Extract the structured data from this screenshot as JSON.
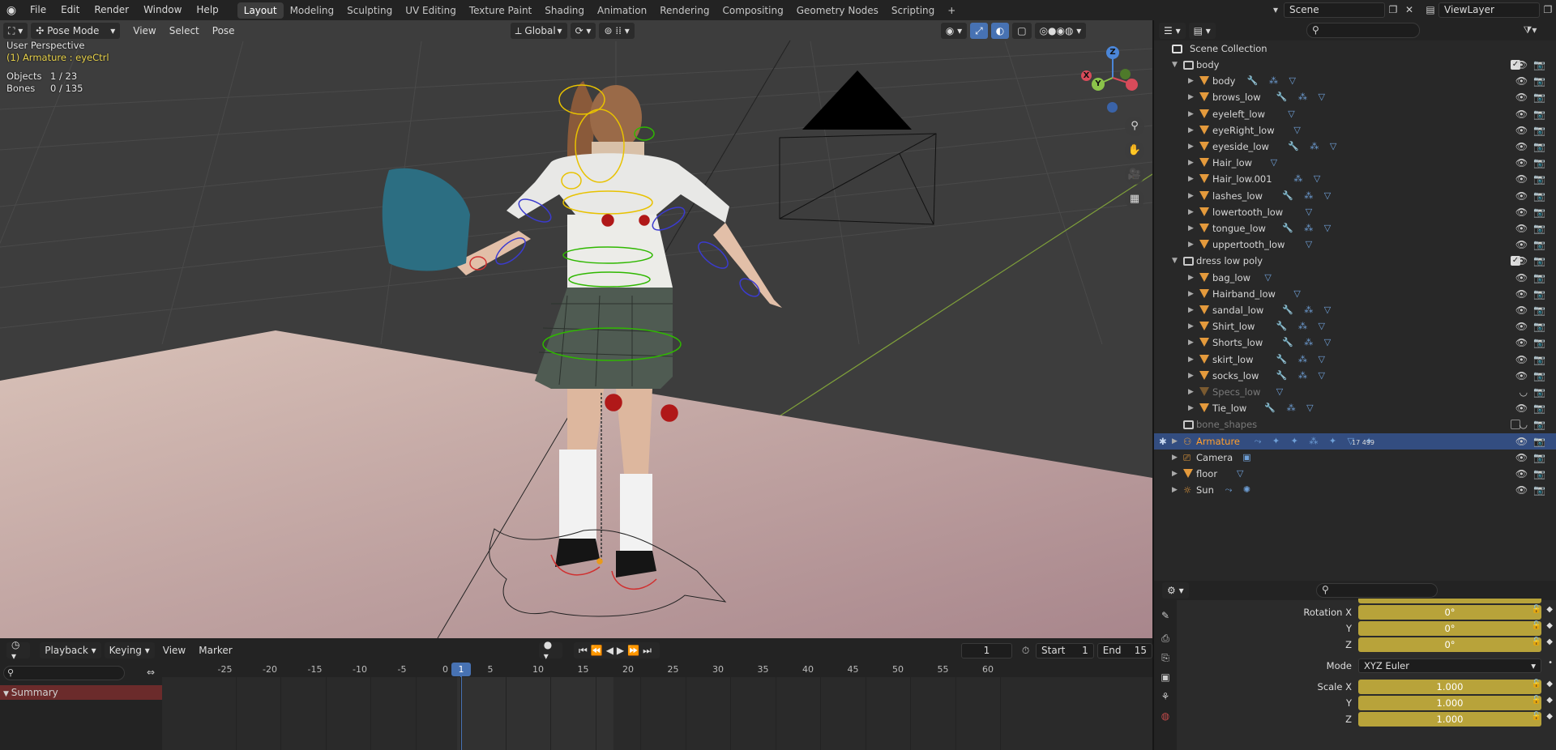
{
  "topbar": {
    "menus": [
      "File",
      "Edit",
      "Render",
      "Window",
      "Help"
    ],
    "workspaces": [
      "Layout",
      "Modeling",
      "Sculpting",
      "UV Editing",
      "Texture Paint",
      "Shading",
      "Animation",
      "Rendering",
      "Compositing",
      "Geometry Nodes",
      "Scripting"
    ],
    "active_workspace": "Layout",
    "add_tab": "+",
    "scene": "Scene",
    "view_layer": "ViewLayer"
  },
  "viewport": {
    "mode": "Pose Mode",
    "menus": [
      "View",
      "Select",
      "Pose"
    ],
    "transform_orientation": "Global",
    "perspective": "User Perspective",
    "active_object": "(1) Armature : eyeCtrl",
    "stats": [
      {
        "label": "Objects",
        "value": "1 / 23"
      },
      {
        "label": "Bones",
        "value": "0 / 135"
      }
    ],
    "gizmo_axes": {
      "z": "Z",
      "y": "Y",
      "x": "X"
    }
  },
  "timeline": {
    "menus": [
      "Playback",
      "Keying",
      "View",
      "Marker"
    ],
    "current_frame": "1",
    "start_label": "Start",
    "start": "1",
    "end_label": "End",
    "end": "15",
    "ruler": [
      "-25",
      "-20",
      "-15",
      "-10",
      "-5",
      "0",
      "5",
      "10",
      "15",
      "20",
      "25",
      "30",
      "35",
      "40",
      "45",
      "50",
      "55",
      "60"
    ],
    "playhead": "1",
    "summary": "Summary"
  },
  "outliner": {
    "root": "Scene Collection",
    "rows": [
      {
        "name": "body",
        "kind": "collection",
        "level": 1,
        "checkbox": true
      },
      {
        "name": "body",
        "kind": "mesh",
        "level": 2,
        "mods": "🔧 ⁂ ▽"
      },
      {
        "name": "brows_low",
        "kind": "mesh",
        "level": 2,
        "mods": "🔧 ⁂ ▽"
      },
      {
        "name": "eyeleft_low",
        "kind": "mesh",
        "level": 2,
        "mods": "▽"
      },
      {
        "name": "eyeRight_low",
        "kind": "mesh",
        "level": 2,
        "mods": "▽"
      },
      {
        "name": "eyeside_low",
        "kind": "mesh",
        "level": 2,
        "mods": "🔧 ⁂ ▽"
      },
      {
        "name": "Hair_low",
        "kind": "mesh",
        "level": 2,
        "mods": "▽"
      },
      {
        "name": "Hair_low.001",
        "kind": "mesh",
        "level": 2,
        "mods": "⁂ ▽"
      },
      {
        "name": "lashes_low",
        "kind": "mesh",
        "level": 2,
        "mods": "🔧 ⁂ ▽"
      },
      {
        "name": "lowertooth_low",
        "kind": "mesh",
        "level": 2,
        "mods": "▽"
      },
      {
        "name": "tongue_low",
        "kind": "mesh",
        "level": 2,
        "mods": "🔧 ⁂ ▽"
      },
      {
        "name": "uppertooth_low",
        "kind": "mesh",
        "level": 2,
        "mods": "▽"
      },
      {
        "name": "dress low poly",
        "kind": "collection",
        "level": 1,
        "checkbox": true
      },
      {
        "name": "bag_low",
        "kind": "mesh",
        "level": 2,
        "mods": "▽"
      },
      {
        "name": "Hairband_low",
        "kind": "mesh",
        "level": 2,
        "mods": "▽"
      },
      {
        "name": "sandal_low",
        "kind": "mesh",
        "level": 2,
        "mods": "🔧 ⁂ ▽"
      },
      {
        "name": "Shirt_low",
        "kind": "mesh",
        "level": 2,
        "mods": "🔧 ⁂ ▽"
      },
      {
        "name": "Shorts_low",
        "kind": "mesh",
        "level": 2,
        "mods": "🔧 ⁂ ▽"
      },
      {
        "name": "skirt_low",
        "kind": "mesh",
        "level": 2,
        "mods": "🔧 ⁂ ▽"
      },
      {
        "name": "socks_low",
        "kind": "mesh",
        "level": 2,
        "mods": "🔧 ⁂ ▽"
      },
      {
        "name": "Specs_low",
        "kind": "mesh",
        "level": 2,
        "mods": "▽",
        "dim": true
      },
      {
        "name": "Tie_low",
        "kind": "mesh",
        "level": 2,
        "mods": "🔧 ⁂ ▽"
      },
      {
        "name": "bone_shapes",
        "kind": "collection",
        "level": 1,
        "dim": true
      },
      {
        "name": "Armature",
        "kind": "armature",
        "level": 1,
        "selected": true,
        "mods": "⤳ ✦ ✦ ⁂ ✦ ▽ ✦",
        "count": "17  499"
      },
      {
        "name": "Camera",
        "kind": "camera",
        "level": 1,
        "mods": "▣"
      },
      {
        "name": "floor",
        "kind": "mesh",
        "level": 1,
        "mods": "▽"
      },
      {
        "name": "Sun",
        "kind": "light",
        "level": 1,
        "mods": "⤳ ✺"
      }
    ]
  },
  "properties": {
    "rotation": [
      {
        "label": "Rotation X",
        "value": "0°"
      },
      {
        "label": "Y",
        "value": "0°"
      },
      {
        "label": "Z",
        "value": "0°"
      }
    ],
    "mode_label": "Mode",
    "mode": "XYZ Euler",
    "scale": [
      {
        "label": "Scale X",
        "value": "1.000"
      },
      {
        "label": "Y",
        "value": "1.000"
      },
      {
        "label": "Z",
        "value": "1.000"
      }
    ]
  },
  "colors": {
    "accent": "#4772b3",
    "selection": "#334d80",
    "active_text": "#ff9f2d",
    "animated_field": "#b8a33a"
  }
}
